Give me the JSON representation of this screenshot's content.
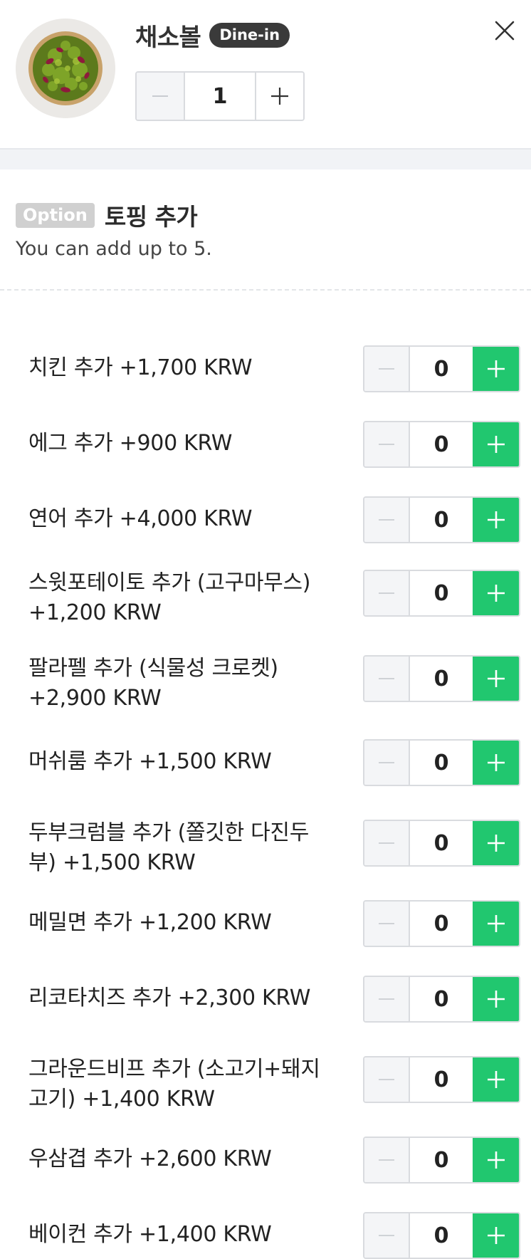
{
  "header": {
    "product_name": "채소볼",
    "badge": "Dine-in",
    "quantity": "1",
    "minus_icon": "minus-icon",
    "plus_icon": "plus-icon",
    "close_icon": "close-icon",
    "image_icon": "salad-bowl-image"
  },
  "option": {
    "badge": "Option",
    "title": "토핑 추가",
    "description": "You can add up to 5."
  },
  "colors": {
    "accent_green": "#21c76f",
    "badge_dark": "#3a3a3a",
    "option_badge_gray": "#d0d0d0"
  },
  "toppings": [
    {
      "label": "치킨 추가 +1,700 KRW",
      "qty": "0"
    },
    {
      "label": "에그 추가 +900 KRW",
      "qty": "0"
    },
    {
      "label": "연어 추가 +4,000 KRW",
      "qty": "0"
    },
    {
      "label": "스윗포테이토 추가 (고구마무스) +1,200 KRW",
      "qty": "0"
    },
    {
      "label": "팔라펠 추가 (식물성 크로켓) +2,900 KRW",
      "qty": "0"
    },
    {
      "label": "머쉬룸 추가 +1,500 KRW",
      "qty": "0"
    },
    {
      "label": "두부크럼블 추가 (쫄깃한 다진두부) +1,500 KRW",
      "qty": "0"
    },
    {
      "label": "메밀면 추가 +1,200 KRW",
      "qty": "0"
    },
    {
      "label": "리코타치즈 추가 +2,300 KRW",
      "qty": "0"
    },
    {
      "label": "그라운드비프 추가 (소고기+돼지고기) +1,400 KRW",
      "qty": "0"
    },
    {
      "label": "우삼겹 추가 +2,600 KRW",
      "qty": "0"
    },
    {
      "label": "베이컨 추가 +1,400 KRW",
      "qty": "0"
    }
  ]
}
